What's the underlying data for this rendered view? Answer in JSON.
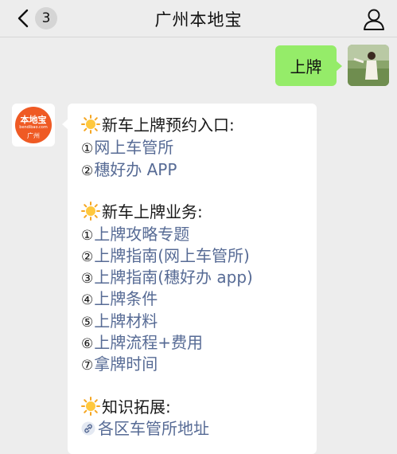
{
  "header": {
    "title": "广州本地宝",
    "unread_count": "3"
  },
  "outgoing": {
    "text": "上牌"
  },
  "incoming": {
    "avatar": {
      "logo_text": "本地宝",
      "logo_url": "bendibao.com",
      "logo_city": "广州"
    },
    "sections": [
      {
        "title": "新车上牌预约入口:",
        "items": [
          {
            "num": "①",
            "label": "网上车管所"
          },
          {
            "num": "②",
            "label": "穗好办 APP"
          }
        ]
      },
      {
        "title": "新车上牌业务:",
        "items": [
          {
            "num": "①",
            "label": "上牌攻略专题"
          },
          {
            "num": "②",
            "label": "上牌指南(网上车管所)"
          },
          {
            "num": "③",
            "label": "上牌指南(穗好办 app)"
          },
          {
            "num": "④",
            "label": "上牌条件"
          },
          {
            "num": "⑤",
            "label": "上牌材料"
          },
          {
            "num": "⑥",
            "label": "上牌流程+费用"
          },
          {
            "num": "⑦",
            "label": "拿牌时间"
          }
        ]
      },
      {
        "title": "知识拓展:",
        "items": [
          {
            "label": "各区车管所地址"
          }
        ]
      }
    ]
  },
  "colors": {
    "background": "#ededed",
    "outgoing_bubble": "#95ec69",
    "link": "#576b95",
    "logo": "#ef5a24"
  },
  "icons": [
    "back-arrow-icon",
    "person-icon",
    "sun-icon",
    "link-chain-icon"
  ]
}
